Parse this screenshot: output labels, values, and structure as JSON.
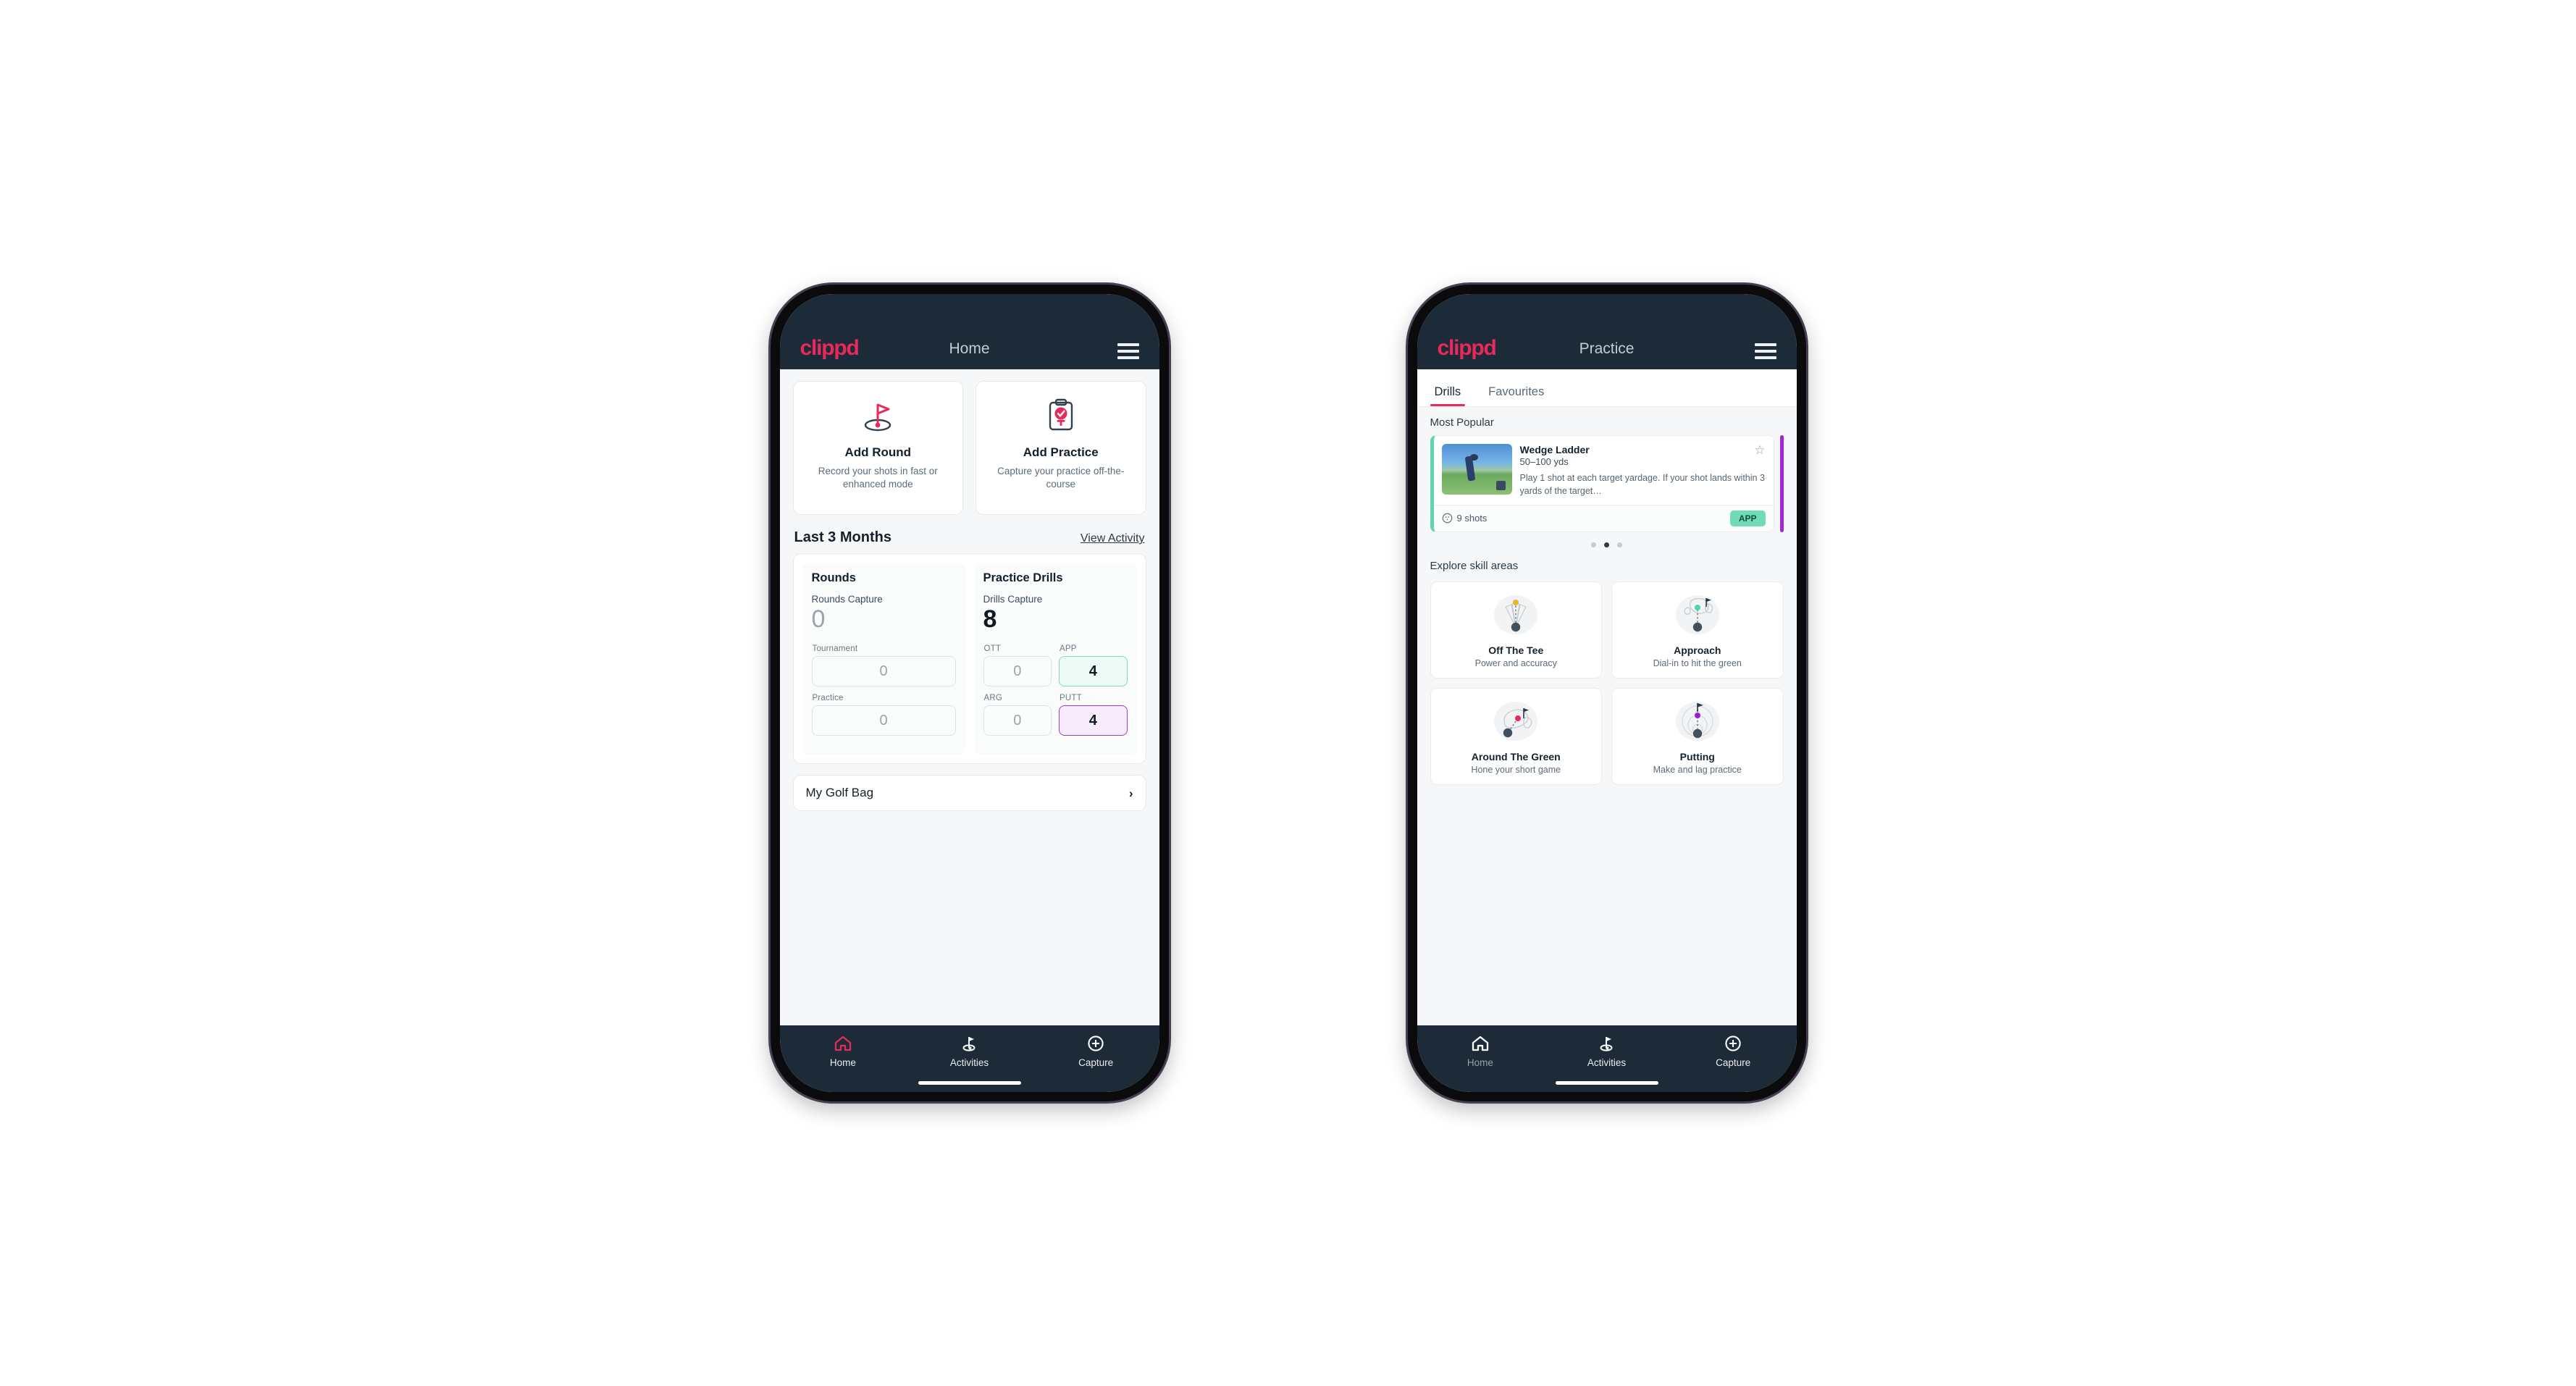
{
  "brand": {
    "logo_text": "clippd",
    "accent": "#e8295b",
    "header_bg": "#1d2b38"
  },
  "home_phone": {
    "header": {
      "title": "Home",
      "menu_icon": "hamburger-menu-icon"
    },
    "quick_actions": [
      {
        "icon": "golf-flag-icon",
        "title": "Add Round",
        "subtitle": "Record your shots in fast or enhanced mode"
      },
      {
        "icon": "clipboard-check-icon",
        "title": "Add Practice",
        "subtitle": "Capture your practice off-the-course"
      }
    ],
    "section": {
      "title": "Last 3 Months",
      "link": "View Activity"
    },
    "rounds": {
      "title": "Rounds",
      "capture_label": "Rounds Capture",
      "capture_value": "0",
      "items": [
        {
          "label": "Tournament",
          "value": "0"
        },
        {
          "label": "Practice",
          "value": "0"
        }
      ]
    },
    "practice_drills": {
      "title": "Practice Drills",
      "capture_label": "Drills Capture",
      "capture_value": "8",
      "items": [
        {
          "label": "OTT",
          "value": "0",
          "highlight": "none"
        },
        {
          "label": "APP",
          "value": "4",
          "highlight": "green"
        },
        {
          "label": "ARG",
          "value": "0",
          "highlight": "none"
        },
        {
          "label": "PUTT",
          "value": "4",
          "highlight": "purple"
        }
      ]
    },
    "golf_bag_row": {
      "label": "My Golf Bag",
      "icon": "chevron-right-icon"
    },
    "tabbar": [
      {
        "icon": "home-icon",
        "label": "Home",
        "active": true
      },
      {
        "icon": "golf-flag-icon",
        "label": "Activities",
        "active": false
      },
      {
        "icon": "plus-circle-icon",
        "label": "Capture",
        "active": false
      }
    ]
  },
  "practice_phone": {
    "header": {
      "title": "Practice",
      "menu_icon": "hamburger-menu-icon"
    },
    "tabs": [
      {
        "label": "Drills",
        "active": true
      },
      {
        "label": "Favourites",
        "active": false
      }
    ],
    "most_popular": {
      "title": "Most Popular",
      "drill": {
        "name": "Wedge Ladder",
        "yardage": "50–100 yds",
        "description": "Play 1 shot at each target yardage. If your shot lands within 3 yards of the target…",
        "shots": "9 shots",
        "shots_icon": "golf-ball-icon",
        "badge": "APP",
        "badge_color": "#6fdcb6",
        "favourite_icon": "star-outline-icon",
        "accent_color": "#5fd6b0",
        "thumbnail": "golfer-practice-photo"
      },
      "dots": [
        false,
        true,
        false
      ]
    },
    "skill_areas": {
      "title": "Explore skill areas",
      "cards": [
        {
          "icon": "off-the-tee-icon",
          "name": "Off The Tee",
          "subtitle": "Power and accuracy",
          "dot_color": "#f0b429"
        },
        {
          "icon": "approach-icon",
          "name": "Approach",
          "subtitle": "Dial-in to hit the green",
          "dot_color": "#4fd4ab"
        },
        {
          "icon": "around-the-green-icon",
          "name": "Around The Green",
          "subtitle": "Hone your short game",
          "dot_color": "#e8295b"
        },
        {
          "icon": "putting-icon",
          "name": "Putting",
          "subtitle": "Make and lag practice",
          "dot_color": "#9b1fd4"
        }
      ]
    },
    "tabbar": [
      {
        "icon": "home-icon",
        "label": "Home",
        "active": false
      },
      {
        "icon": "golf-flag-icon",
        "label": "Activities",
        "active": true
      },
      {
        "icon": "plus-circle-icon",
        "label": "Capture",
        "active": false
      }
    ]
  }
}
